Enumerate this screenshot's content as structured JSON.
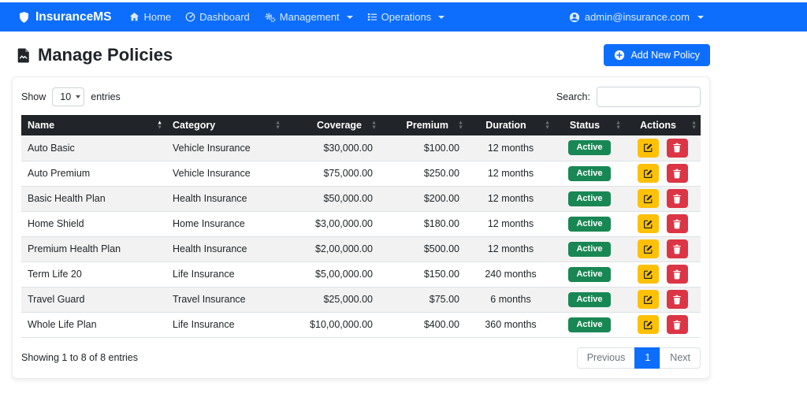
{
  "navbar": {
    "brand": "InsuranceMS",
    "items": [
      {
        "label": "Home",
        "icon": "house-icon",
        "dropdown": false
      },
      {
        "label": "Dashboard",
        "icon": "speedometer-icon",
        "dropdown": false
      },
      {
        "label": "Management",
        "icon": "gears-icon",
        "dropdown": true
      },
      {
        "label": "Operations",
        "icon": "list-check-icon",
        "dropdown": true
      }
    ],
    "user_email": "admin@insurance.com"
  },
  "page": {
    "title": "Manage Policies",
    "add_button_label": "Add New Policy"
  },
  "controls": {
    "show_label": "Show",
    "page_length": "10",
    "entries_label": "entries",
    "search_label": "Search:",
    "search_value": ""
  },
  "table": {
    "columns": [
      {
        "label": "Name",
        "sort": "asc"
      },
      {
        "label": "Category",
        "sort": "none"
      },
      {
        "label": "Coverage",
        "sort": "none"
      },
      {
        "label": "Premium",
        "sort": "none"
      },
      {
        "label": "Duration",
        "sort": "none"
      },
      {
        "label": "Status",
        "sort": "none"
      },
      {
        "label": "Actions",
        "sort": "none"
      }
    ],
    "rows": [
      {
        "name": "Auto Basic",
        "category": "Vehicle Insurance",
        "coverage": "$30,000.00",
        "premium": "$100.00",
        "duration": "12 months",
        "status": "Active"
      },
      {
        "name": "Auto Premium",
        "category": "Vehicle Insurance",
        "coverage": "$75,000.00",
        "premium": "$250.00",
        "duration": "12 months",
        "status": "Active"
      },
      {
        "name": "Basic Health Plan",
        "category": "Health Insurance",
        "coverage": "$50,000.00",
        "premium": "$200.00",
        "duration": "12 months",
        "status": "Active"
      },
      {
        "name": "Home Shield",
        "category": "Home Insurance",
        "coverage": "$3,00,000.00",
        "premium": "$180.00",
        "duration": "12 months",
        "status": "Active"
      },
      {
        "name": "Premium Health Plan",
        "category": "Health Insurance",
        "coverage": "$2,00,000.00",
        "premium": "$500.00",
        "duration": "12 months",
        "status": "Active"
      },
      {
        "name": "Term Life 20",
        "category": "Life Insurance",
        "coverage": "$5,00,000.00",
        "premium": "$150.00",
        "duration": "240 months",
        "status": "Active"
      },
      {
        "name": "Travel Guard",
        "category": "Travel Insurance",
        "coverage": "$25,000.00",
        "premium": "$75.00",
        "duration": "6 months",
        "status": "Active"
      },
      {
        "name": "Whole Life Plan",
        "category": "Life Insurance",
        "coverage": "$10,00,000.00",
        "premium": "$400.00",
        "duration": "360 months",
        "status": "Active"
      }
    ]
  },
  "footer": {
    "summary": "Showing 1 to 8 of 8 entries",
    "previous_label": "Previous",
    "current_page": "1",
    "next_label": "Next"
  },
  "colors": {
    "primary": "#0d6efd",
    "success": "#198754",
    "warning": "#ffc107",
    "danger": "#dc3545",
    "table_header_bg": "#212529"
  }
}
